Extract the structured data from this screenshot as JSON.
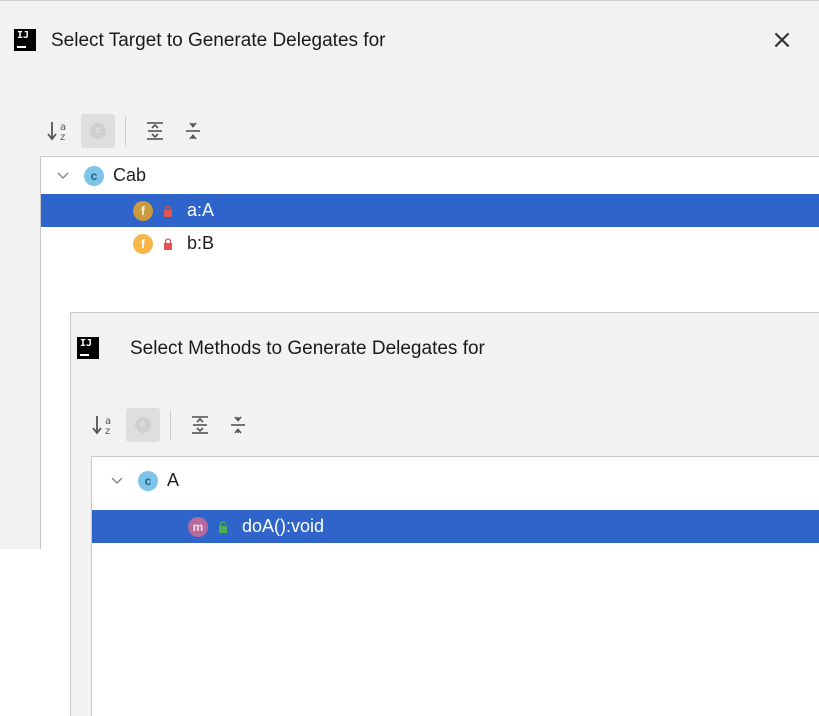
{
  "dialog_target": {
    "title": "Select Target to Generate Delegates for",
    "close_label": "×",
    "logo_text": "IJ",
    "toolbar": {
      "sort_icon": "sort-alphabetically-icon",
      "class_filter_icon": "show-classes-icon",
      "expand_icon": "expand-all-icon",
      "collapse_icon": "collapse-all-icon"
    },
    "tree": {
      "root": {
        "badge": "c",
        "label": "Cab",
        "icon": "class-icon",
        "expanded": true
      },
      "children": [
        {
          "badge": "f",
          "label": "a:A",
          "icon": "field-icon",
          "visibility": "private",
          "selected": true
        },
        {
          "badge": "f",
          "label": "b:B",
          "icon": "field-icon",
          "visibility": "private",
          "selected": false
        }
      ]
    }
  },
  "dialog_methods": {
    "title": "Select Methods to Generate Delegates for",
    "logo_text": "IJ",
    "toolbar": {
      "sort_icon": "sort-alphabetically-icon",
      "class_filter_icon": "show-classes-icon",
      "expand_icon": "expand-all-icon",
      "collapse_icon": "collapse-all-icon"
    },
    "tree": {
      "root": {
        "badge": "c",
        "label": "A",
        "icon": "class-icon",
        "expanded": true
      },
      "children": [
        {
          "badge": "m",
          "label": "doA():void",
          "icon": "method-icon",
          "visibility": "public",
          "selected": true
        }
      ]
    }
  },
  "colors": {
    "selection": "#2f65ca",
    "dialog_bg": "#f2f2f2",
    "class_badge": "#7dc4e8",
    "field_badge": "#f7b54a",
    "method_badge": "#c56fa6",
    "private_lock": "#e0554f",
    "public_lock": "#4caf50"
  }
}
